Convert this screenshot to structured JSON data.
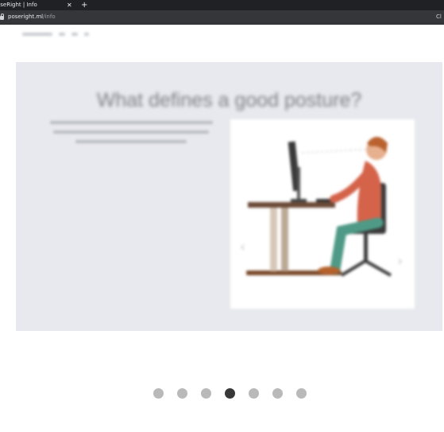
{
  "browser": {
    "tab_title": "oseRight | Info",
    "tab_close": "✕",
    "new_tab": "+",
    "url_host": "poseright.ml",
    "url_path": "/info",
    "toolbar_right": "Cl"
  },
  "hero": {
    "title": "What defines a good posture?"
  },
  "carousel": {
    "dot_count": 7,
    "active_index": 3
  },
  "colors": {
    "dot": "#b9b9b9",
    "dot_active": "#383838",
    "hero_bg": "#e8e9ee"
  }
}
